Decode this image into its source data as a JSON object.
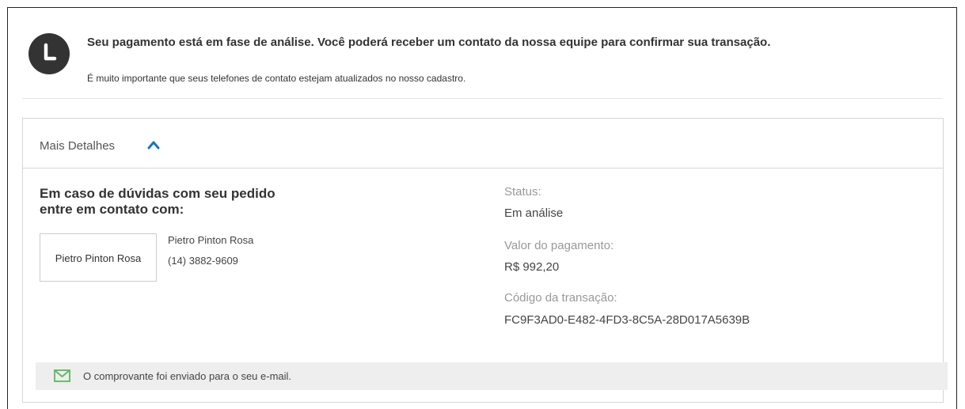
{
  "notice": {
    "title": "Seu pagamento está em fase de análise. Você poderá receber um contato da nossa equipe para confirmar sua transação.",
    "subtitle": "É muito importante que seus telefones de contato estejam atualizados no nosso cadastro.",
    "icon": "clock-icon"
  },
  "details_panel": {
    "header_label": "Mais Detalhes",
    "toggle_icon": "chevron-up-icon",
    "accent_color": "#1a73c7",
    "contact": {
      "title": "Em caso de dúvidas com seu pedido entre em contato com:",
      "card_label": "Pietro Pinton Rosa",
      "name": "Pietro Pinton Rosa",
      "phone": "(14) 3882-9609"
    },
    "fields": [
      {
        "label": "Status:",
        "value": "Em análise"
      },
      {
        "label": "Valor do pagamento:",
        "value": "R$ 992,20"
      },
      {
        "label": "Código da transação:",
        "value": "FC9F3AD0-E482-4FD3-8C5A-28D017A5639B"
      }
    ],
    "footer": {
      "text": "O comprovante foi enviado para o seu e-mail.",
      "icon": "mail-icon",
      "icon_color": "#5cb85c"
    }
  }
}
